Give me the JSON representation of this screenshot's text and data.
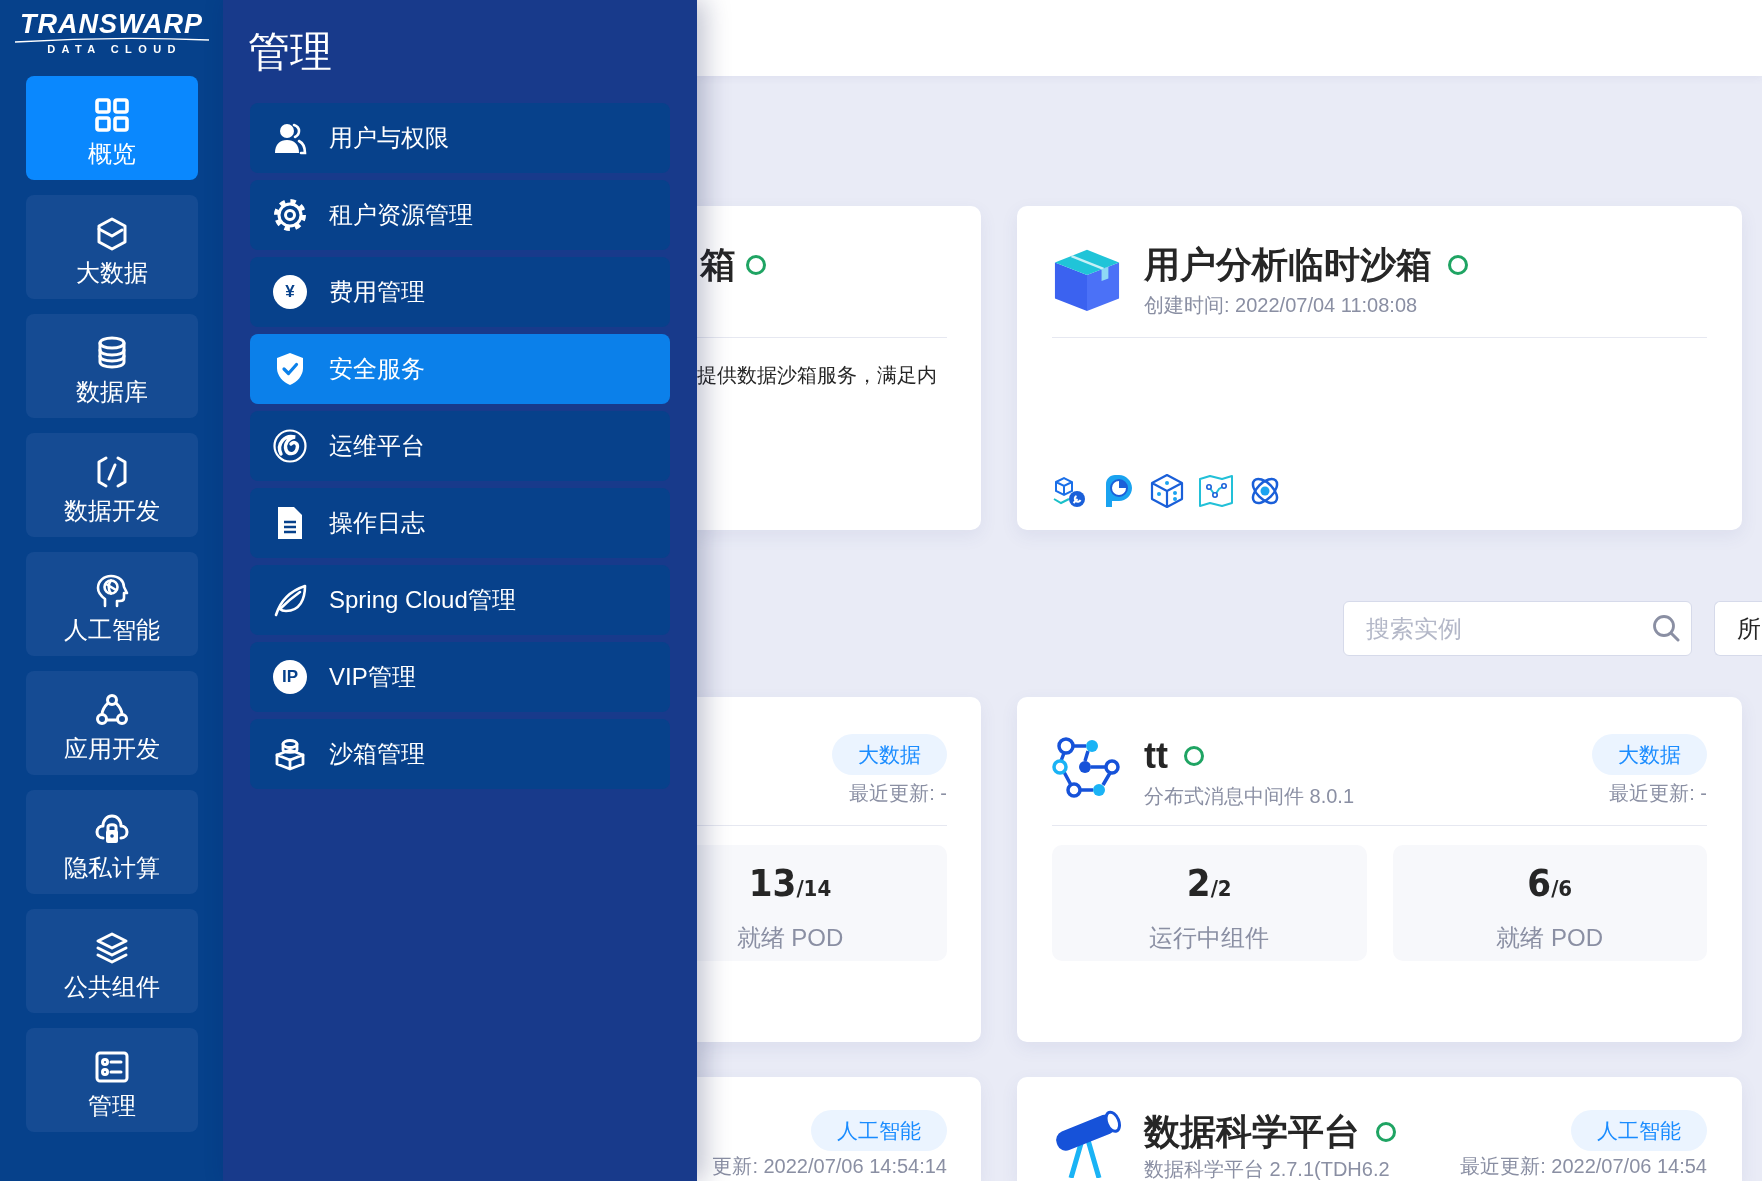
{
  "sidebar": {
    "logo": {
      "name": "TRANSWARP",
      "tagline": "DATA CLOUD"
    },
    "items": [
      {
        "label": "概览",
        "selected": true
      },
      {
        "label": "大数据",
        "selected": false
      },
      {
        "label": "数据库",
        "selected": false
      },
      {
        "label": "数据开发",
        "selected": false
      },
      {
        "label": "人工智能",
        "selected": false
      },
      {
        "label": "应用开发",
        "selected": false
      },
      {
        "label": "隐私计算",
        "selected": false
      },
      {
        "label": "公共组件",
        "selected": false
      },
      {
        "label": "管理",
        "selected": false
      }
    ]
  },
  "flyout": {
    "title": "管理",
    "items": [
      {
        "label": "用户与权限",
        "selected": false
      },
      {
        "label": "租户资源管理",
        "selected": false
      },
      {
        "label": "费用管理",
        "selected": false,
        "icon_text": "¥"
      },
      {
        "label": "安全服务",
        "selected": true
      },
      {
        "label": "运维平台",
        "selected": false
      },
      {
        "label": "操作日志",
        "selected": false
      },
      {
        "label": "Spring Cloud管理",
        "selected": false
      },
      {
        "label": "VIP管理",
        "selected": false,
        "icon_text": "IP"
      },
      {
        "label": "沙箱管理",
        "selected": false
      }
    ]
  },
  "sandboxes": [
    {
      "title": "箱",
      "running": true,
      "description": "提供数据沙箱服务，满足内"
    },
    {
      "title": "用户分析临时沙箱",
      "running": true,
      "created": "创建时间: 2022/07/04 11:08:08"
    }
  ],
  "search": {
    "placeholder": "搜索实例"
  },
  "filter": {
    "value": "所"
  },
  "instances": [
    {
      "tag": "大数据",
      "updated": "最近更新: -",
      "stats": [
        {
          "value": "13",
          "total": "/14",
          "label": "就绪 POD"
        }
      ]
    },
    {
      "title": "tt",
      "running": true,
      "subtitle": "分布式消息中间件 8.0.1",
      "tag": "大数据",
      "updated": "最近更新: -",
      "stats": [
        {
          "value": "2",
          "total": "/2",
          "label": "运行中组件"
        },
        {
          "value": "6",
          "total": "/6",
          "label": "就绪 POD"
        }
      ]
    },
    {
      "tag": "人工智能",
      "updated": "更新: 2022/07/06 14:54:14"
    },
    {
      "title": "数据科学平台",
      "running": true,
      "subtitle": "数据科学平台 2.7.1(TDH6.2",
      "tag": "人工智能",
      "updated": "最近更新: 2022/07/06 14:54"
    }
  ]
}
